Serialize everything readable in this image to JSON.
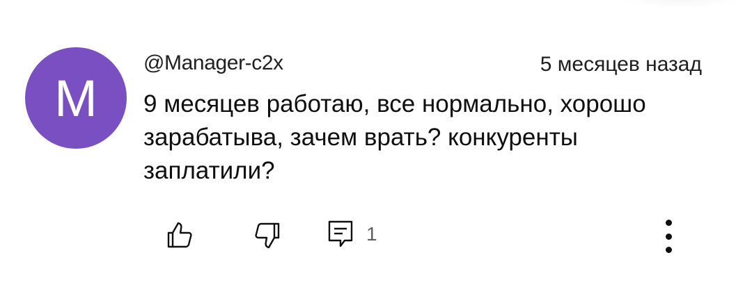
{
  "comment": {
    "avatar_letter": "M",
    "avatar_color": "#7a4fc2",
    "author": "@Manager-c2x",
    "timestamp": "5 месяцев назад",
    "text": "9 месяцев работаю, все нормально, хорошо зарабатыва, зачем врать? конкуренты заплатили?"
  },
  "actions": {
    "like_icon": "thumbs-up-icon",
    "dislike_icon": "thumbs-down-icon",
    "reply_icon": "comment-icon",
    "reply_count": "1",
    "more_icon": "more-vertical-icon"
  }
}
